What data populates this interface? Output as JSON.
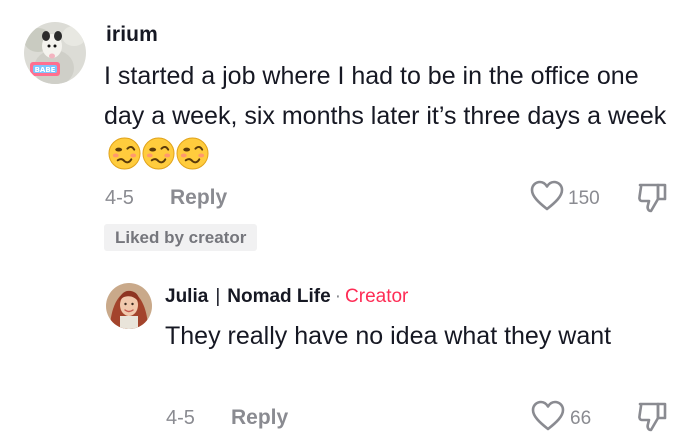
{
  "comment": {
    "username": "irium",
    "text": "I started a job where I had to be in the office one day a week, six months later it’s three days a week",
    "emojis": [
      "woozy-face",
      "woozy-face",
      "woozy-face"
    ],
    "date": "4-5",
    "reply_label": "Reply",
    "likes": "150",
    "badge": "Liked by creator",
    "avatar_badge_text": "BABE"
  },
  "reply": {
    "name": "Julia",
    "separator": "|",
    "channel": "Nomad Life",
    "dot": "·",
    "role": "Creator",
    "text": "They really have no idea what they want",
    "date": "4-5",
    "reply_label": "Reply",
    "likes": "66"
  },
  "colors": {
    "text": "#161823",
    "muted": "#8a8b91",
    "creator": "#fe2c55",
    "badge_bg": "#f1f1f2"
  }
}
